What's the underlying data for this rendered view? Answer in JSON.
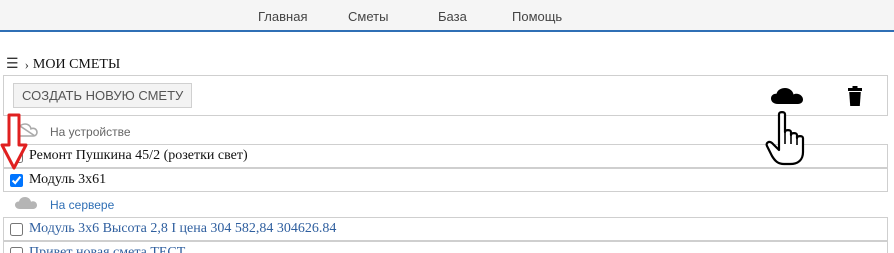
{
  "nav": {
    "home": "Главная",
    "estimates": "Сметы",
    "base": "База",
    "help": "Помощь"
  },
  "breadcrumb": {
    "menu_icon": "☰",
    "arrow": "›",
    "title": "МОИ СМЕТЫ"
  },
  "toolbar": {
    "create_label": "СОЗДАТЬ НОВУЮ СМЕТУ",
    "cloud_icon": "cloud-icon",
    "trash_icon": "trash-icon"
  },
  "sections": {
    "device": "На устройстве",
    "server": "На сервере"
  },
  "device_items": [
    {
      "label": "Ремонт Пушкина 45/2 (розетки свет)",
      "checked": false
    },
    {
      "label": "Модуль 3х61",
      "checked": true
    }
  ],
  "server_items": [
    {
      "label": "Модуль 3х6 Высота 2,8 I цена 304 582,84 304626.84",
      "checked": false
    },
    {
      "label": "Привет новая смета ТЕСТ",
      "checked": false
    }
  ],
  "colors": {
    "accent": "#2f6fb5",
    "link": "#2f5f9f",
    "annotation_arrow": "#e02020"
  }
}
